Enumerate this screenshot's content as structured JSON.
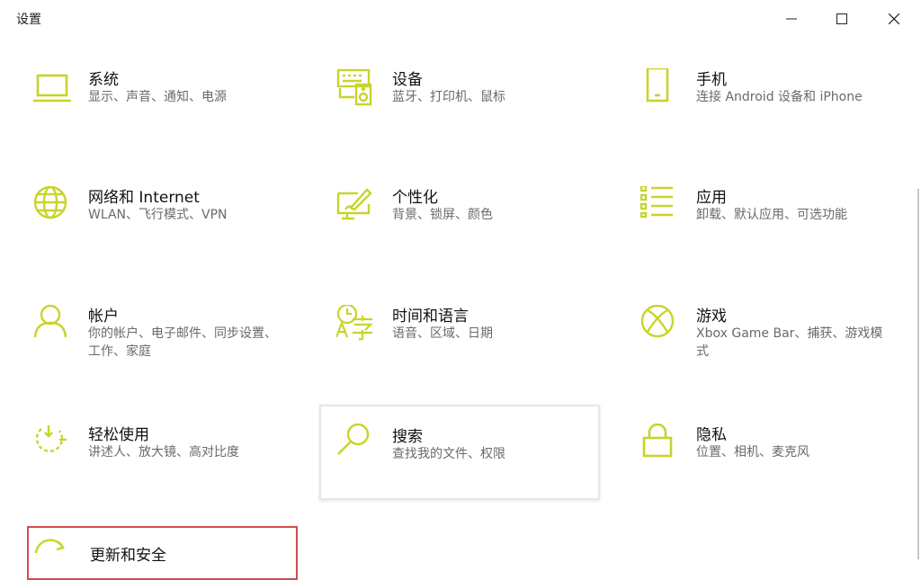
{
  "window": {
    "title": "设置",
    "accent": "#c8d42a",
    "controls": {
      "minimize": "minimize-icon",
      "maximize": "maximize-icon",
      "close": "close-icon"
    }
  },
  "tiles": [
    {
      "name": "系统",
      "desc": "显示、声音、通知、电源",
      "icon": "laptop-icon"
    },
    {
      "name": "设备",
      "desc": "蓝牙、打印机、鼠标",
      "icon": "keyboard-speaker-icon"
    },
    {
      "name": "手机",
      "desc": "连接 Android 设备和 iPhone",
      "icon": "phone-icon"
    },
    {
      "name": "网络和 Internet",
      "desc": "WLAN、飞行模式、VPN",
      "icon": "globe-icon"
    },
    {
      "name": "个性化",
      "desc": "背景、锁屏、颜色",
      "icon": "paint-brush-icon"
    },
    {
      "name": "应用",
      "desc": "卸载、默认应用、可选功能",
      "icon": "apps-list-icon"
    },
    {
      "name": "帐户",
      "desc": "你的帐户、电子邮件、同步设置、工作、家庭",
      "icon": "person-icon"
    },
    {
      "name": "时间和语言",
      "desc": "语音、区域、日期",
      "icon": "time-language-icon"
    },
    {
      "name": "游戏",
      "desc": "Xbox Game Bar、捕获、游戏模式",
      "icon": "xbox-icon"
    },
    {
      "name": "轻松使用",
      "desc": "讲述人、放大镜、高对比度",
      "icon": "ease-of-access-icon"
    },
    {
      "name": "搜索",
      "desc": "查找我的文件、权限",
      "icon": "search-icon"
    },
    {
      "name": "隐私",
      "desc": "位置、相机、麦克风",
      "icon": "lock-icon"
    },
    {
      "name": "更新和安全",
      "desc": "",
      "icon": "update-icon"
    }
  ]
}
